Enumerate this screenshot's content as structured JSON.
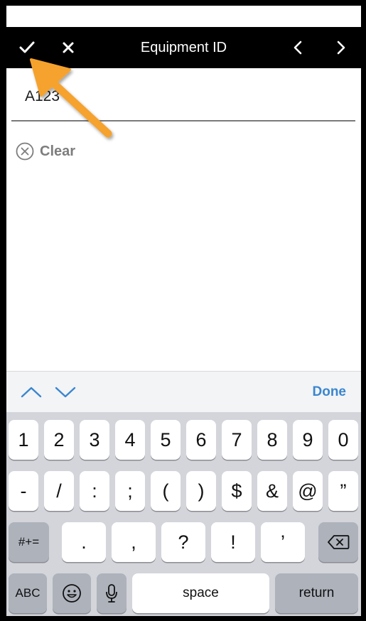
{
  "navbar": {
    "title": "Equipment ID",
    "confirm_icon": "checkmark-icon",
    "cancel_icon": "close-icon",
    "prev_icon": "chevron-left-icon",
    "next_icon": "chevron-right-icon"
  },
  "field": {
    "value": "A123",
    "clear_label": "Clear",
    "clear_icon": "clear-circle-x-icon"
  },
  "accessory": {
    "up_icon": "chevron-up-icon",
    "down_icon": "chevron-down-icon",
    "done_label": "Done"
  },
  "keyboard": {
    "row1": [
      "1",
      "2",
      "3",
      "4",
      "5",
      "6",
      "7",
      "8",
      "9",
      "0"
    ],
    "row2": [
      "-",
      "/",
      ":",
      ";",
      "(",
      ")",
      "$",
      "&",
      "@",
      "”"
    ],
    "row3_left": "#+=",
    "row3": [
      ".",
      ",",
      "?",
      "!",
      "’"
    ],
    "row3_right_icon": "backspace-icon",
    "row4": {
      "abc": "ABC",
      "emoji_icon": "emoji-icon",
      "mic_icon": "microphone-icon",
      "space": "space",
      "return": "return"
    }
  },
  "annotation": {
    "arrow_icon": "orange-arrow-icon",
    "color": "#f5a22d"
  },
  "colors": {
    "navbar_bg": "#000000",
    "accent": "#3a86cf",
    "keyboard_bg": "#d3d5db",
    "func_key": "#adb2bb"
  }
}
